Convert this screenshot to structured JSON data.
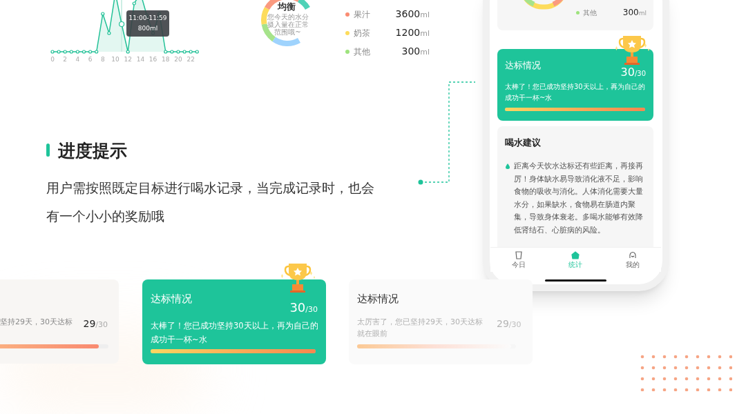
{
  "hourly_chart": {
    "x_labels": [
      "0",
      "2",
      "4",
      "6",
      "8",
      "10",
      "12",
      "14",
      "16",
      "18",
      "20",
      "22"
    ],
    "tooltip": {
      "time": "11:00-11:59",
      "amount": "800ml"
    }
  },
  "balance_donut": {
    "title": "均衡",
    "subtitle": "您今天的水分摄入量在正常范围哦~"
  },
  "legend": [
    {
      "label": "果汁",
      "value": "3600",
      "unit": "ml",
      "color": "#fa8c72"
    },
    {
      "label": "奶茶",
      "value": "1200",
      "unit": "ml",
      "color": "#fddc5c"
    },
    {
      "label": "其他",
      "value": "300",
      "unit": "ml",
      "color": "#9ee37d"
    }
  ],
  "section": {
    "heading": "进度提示",
    "description": "用户需按照既定目标进行喝水记录，当完成记录时，也会有一个小小的奖励哦"
  },
  "phone": {
    "legend": [
      {
        "label": "其他",
        "value": "300",
        "unit": "ml",
        "color": "#9ee37d"
      }
    ],
    "achievement": {
      "title": "达标情况",
      "score": "30",
      "total": "/30",
      "message": "太棒了！您已成功坚持30天以上，再为自己的成功干一杯~水",
      "level": 1
    },
    "advice": {
      "title": "喝水建议",
      "text": "距离今天饮水达标还有些距离，再接再厉！身体缺水易导致消化液不足，影响食物的吸收与消化。人体消化需要大量水分，如果缺水，食物易在肠道内聚集，导致身体衰老。多喝水能够有效降低肾结石、心脏病的风险。"
    },
    "tabs": [
      {
        "label": "今日",
        "selected": false
      },
      {
        "label": "统计",
        "selected": true
      },
      {
        "label": "我的",
        "selected": false
      }
    ]
  },
  "cards": [
    {
      "kind": "progress",
      "message": "坚持29天，30天达标",
      "score": "29",
      "total": "/30",
      "level": 0.93
    },
    {
      "kind": "complete",
      "title": "达标情况",
      "message": "太棒了！您已成功坚持30天以上，再为自己的成功干一杯~水",
      "score": "30",
      "total": "/30",
      "level": 1
    },
    {
      "kind": "faded",
      "title": "达标情况",
      "message": "太厉害了，您已坚持29天，30天达标就在眼前",
      "score": "29",
      "total": "/30",
      "level": 0.97
    }
  ]
}
